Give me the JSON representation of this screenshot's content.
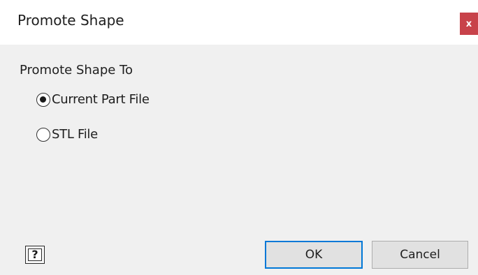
{
  "window": {
    "title": "Promote Shape",
    "close_label": "x"
  },
  "group": {
    "label": "Promote Shape To",
    "options": [
      {
        "label": "Current Part File",
        "selected": true
      },
      {
        "label": "STL File",
        "selected": false
      }
    ]
  },
  "footer": {
    "help_icon": "help-icon",
    "help_label": "?",
    "ok_label": "OK",
    "cancel_label": "Cancel"
  },
  "colors": {
    "close_button": "#c8424a",
    "default_button_border": "#0078d7"
  }
}
